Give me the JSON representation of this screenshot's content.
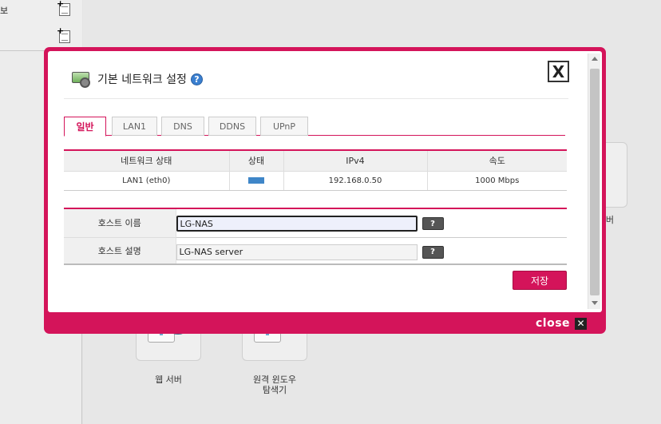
{
  "background": {
    "sidebar_items": [
      {
        "label": "보"
      },
      {
        "label": ""
      }
    ],
    "apps": [
      {
        "caption": "웹 서버"
      },
      {
        "caption": "원격 윈도우\n탐색기"
      },
      {
        "caption": "버"
      }
    ]
  },
  "dialog": {
    "title": "기본 네트워크 설정",
    "help_icon": "?",
    "close_icon": "X",
    "tabs": [
      "일반",
      "LAN1",
      "DNS",
      "DDNS",
      "UPnP"
    ],
    "active_tab": "일반",
    "status_table": {
      "headers": [
        "네트워크 상태",
        "상태",
        "IPv4",
        "속도"
      ],
      "row": {
        "name": "LAN1 (eth0)",
        "ipv4": "192.168.0.50",
        "speed": "1000 Mbps"
      }
    },
    "form": {
      "hostname_label": "호스트 이름",
      "hostname_value": "LG-NAS",
      "description_label": "호스트 설명",
      "description_value": "LG-NAS server",
      "help_button": "?"
    },
    "save_label": "저장",
    "footer_close_label": "close",
    "footer_close_icon": "✕",
    "accent_color": "#d4145a"
  }
}
